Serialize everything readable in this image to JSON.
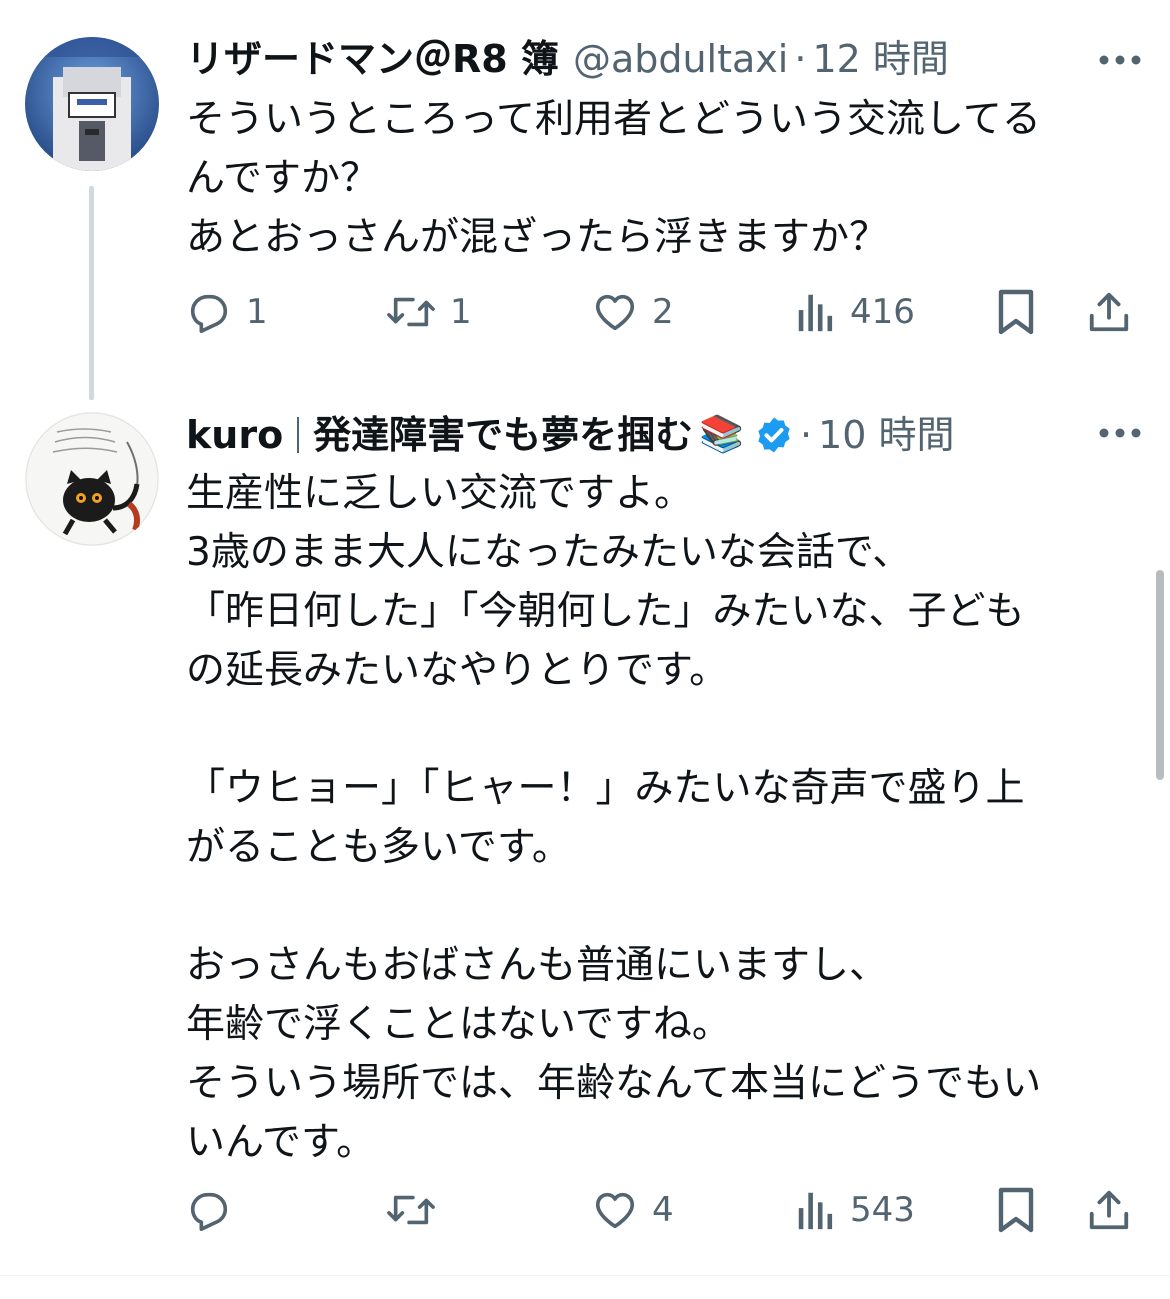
{
  "tweets": [
    {
      "display_name": "リザードマン＠R8 簿",
      "handle": "@abdultaxi",
      "separator": "·",
      "time": "12 時間",
      "lines": [
        "そういうところって利用者とどういう交流してる",
        "んですか？",
        "あとおっさんが混ざったら浮きますか？"
      ],
      "stats": {
        "replies": "1",
        "retweets": "1",
        "likes": "2",
        "views": "416"
      }
    },
    {
      "display_name": "kuro",
      "name_suffix": "発達障害でも夢を掴む",
      "emoji": "📚",
      "verified": true,
      "separator": "·",
      "time": "10 時間",
      "lines": [
        "生産性に乏しい交流ですよ。",
        "3歳のまま大人になったみたいな会話で、",
        "「昨日何した」「今朝何した」みたいな、子ども",
        "の延長みたいなやりとりです。",
        "",
        "「ウヒョー」「ヒャー！」みたいな奇声で盛り上",
        "がることも多いです。",
        "",
        "おっさんもおばさんも普通にいますし、",
        "年齢で浮くことはないですね。",
        "そういう場所では、年齢なんて本当にどうでもい",
        "いんです。"
      ],
      "stats": {
        "replies": "",
        "retweets": "",
        "likes": "4",
        "views": "543"
      }
    }
  ],
  "icons": {
    "more": "more-horizontal-icon",
    "reply": "reply-icon",
    "retweet": "retweet-icon",
    "like": "heart-icon",
    "views": "views-chart-icon",
    "bookmark": "bookmark-icon",
    "share": "share-icon",
    "verified": "verified-badge-icon"
  },
  "colors": {
    "text_primary": "#0f1419",
    "text_secondary": "#536471",
    "verified_blue": "#1d9bf0",
    "thread_line": "#cfd9de"
  }
}
